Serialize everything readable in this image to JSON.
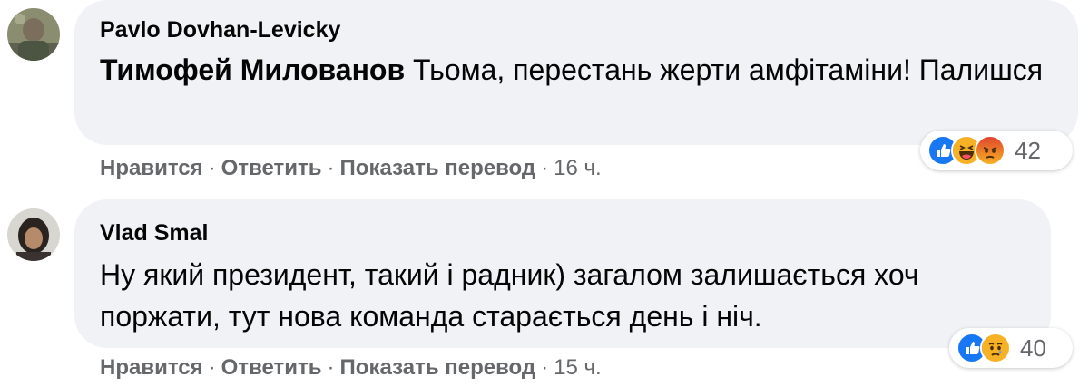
{
  "comments": [
    {
      "author": "Pavlo Dovhan-Levicky",
      "tag": "Тимофей Милованов",
      "text": " Тьома, перестань жерти амфітаміни! Палишся",
      "reactions": {
        "icons": [
          "like-icon",
          "haha-icon",
          "angry-icon"
        ],
        "count": "42"
      },
      "actions": {
        "like": "Нравится",
        "reply": "Ответить",
        "translate": "Показать перевод",
        "time": "16 ч.",
        "separator": "·"
      }
    },
    {
      "author": "Vlad Smal",
      "tag": "",
      "text": "Ну який президент, такий і радник) загалом залишається хоч поржати, тут нова команда старається день і ніч.",
      "reactions": {
        "icons": [
          "like-icon",
          "sad-icon"
        ],
        "count": "40"
      },
      "actions": {
        "like": "Нравится",
        "reply": "Ответить",
        "translate": "Показать перевод",
        "time": "15 ч.",
        "separator": "·"
      }
    }
  ],
  "colors": {
    "bubble": "#f0f2f5",
    "meta": "#65676b",
    "like": "#1877f2",
    "emoji": "#f7b125",
    "angry": "#e9710f"
  }
}
